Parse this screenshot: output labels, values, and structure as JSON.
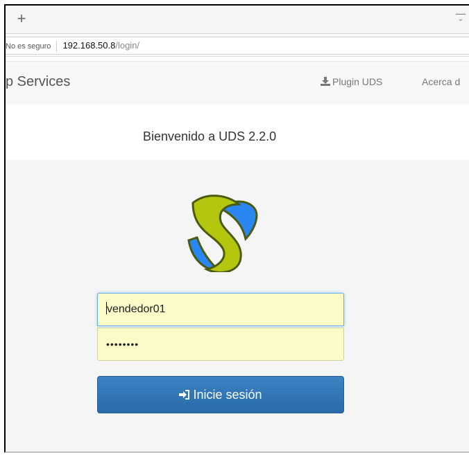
{
  "browser": {
    "new_tab_label": "+",
    "address": {
      "security_label": "No es seguro",
      "host": "192.168.50.8",
      "path": "/login/"
    }
  },
  "navbar": {
    "brand": "p Services",
    "plugin_label": "Plugin UDS",
    "about_label": "Acerca d"
  },
  "welcome": {
    "title": "Bienvenido a UDS 2.2.0"
  },
  "login": {
    "username_value": "vendedor01",
    "password_value": "••••••••",
    "submit_label": "Inicie sesión"
  },
  "colors": {
    "input_bg": "#fafbc6",
    "button": "#2f74b5",
    "logo_green": "#b5c60f",
    "logo_blue": "#2a86f0"
  }
}
